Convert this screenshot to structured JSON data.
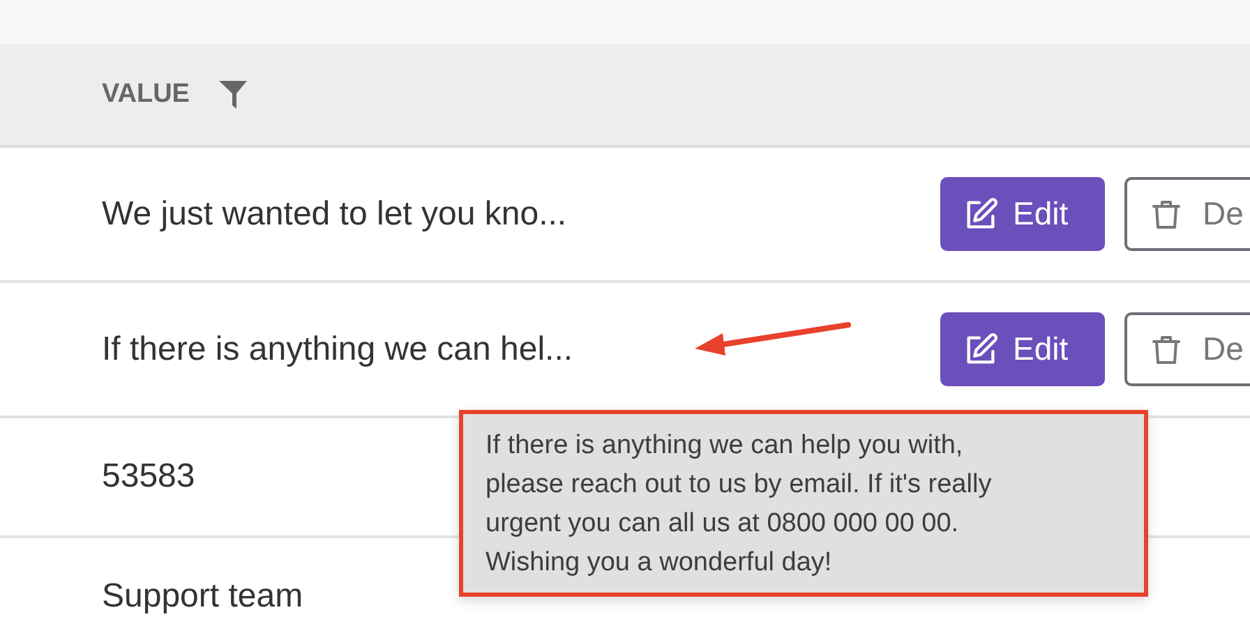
{
  "table": {
    "columns": [
      {
        "label": "VALUE"
      }
    ],
    "rows": [
      {
        "value": "We just wanted to let you kno...",
        "buttons": [
          {
            "kind": "edit",
            "label": "Edit"
          },
          {
            "kind": "delete",
            "label": "De"
          }
        ]
      },
      {
        "value": "If there is anything we can hel...",
        "buttons": [
          {
            "kind": "edit",
            "label": "Edit"
          },
          {
            "kind": "delete",
            "label": "De"
          }
        ]
      },
      {
        "value": "53583",
        "buttons": []
      },
      {
        "value": "Support team",
        "buttons": []
      }
    ]
  },
  "tooltip": {
    "lines": [
      "If there is anything we can help you with,",
      "please reach out to us by email. If it's really",
      "urgent you can all us at 0800 000 00 00.",
      "Wishing you a wonderful day!"
    ]
  }
}
